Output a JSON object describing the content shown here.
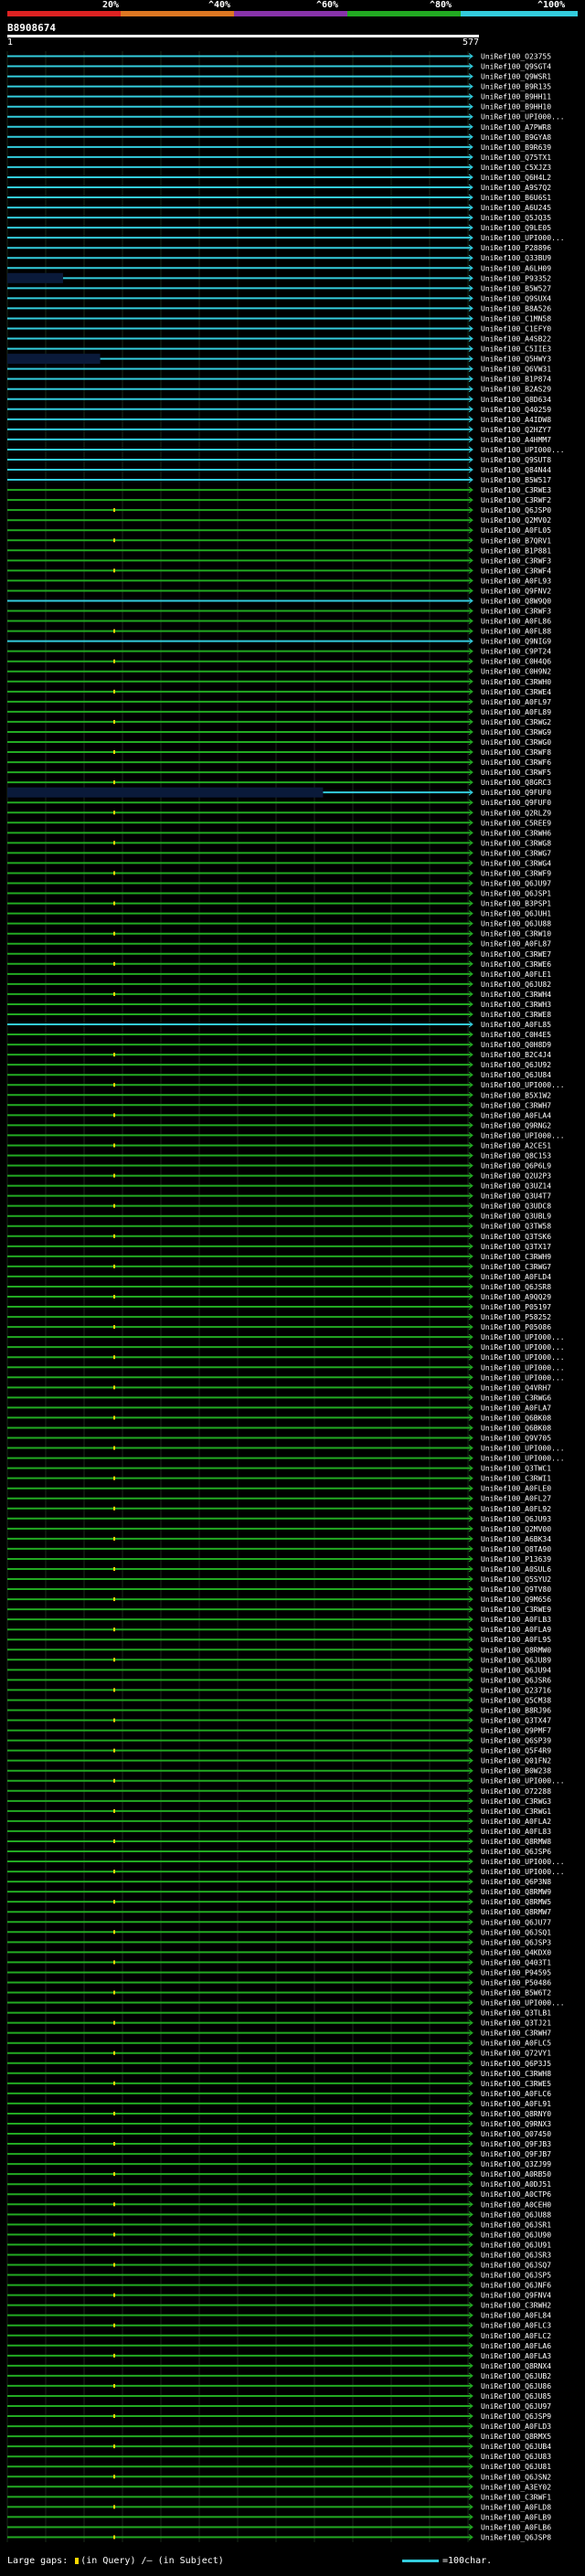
{
  "scale": {
    "labels": [
      "20%",
      "^40%",
      "^60%",
      "^80%",
      "^100%"
    ],
    "colors": [
      "#dd2222",
      "#dd7722",
      "#8833aa",
      "#22aa22",
      "#33ccdd"
    ]
  },
  "query": {
    "id": "B8908674",
    "start": "1",
    "end": "577"
  },
  "colors": {
    "cyan": "#33ccdd",
    "green": "#22aa22",
    "navy": "#0a1a3a",
    "dot": "#ffd700"
  },
  "hits": [
    {
      "id": "UniRef100_O23755",
      "c": "c"
    },
    {
      "id": "UniRef100_Q9SGT4",
      "c": "c"
    },
    {
      "id": "UniRef100_Q9WSR1",
      "c": "c"
    },
    {
      "id": "UniRef100_B9R135",
      "c": "c"
    },
    {
      "id": "UniRef100_B9HH11",
      "c": "c"
    },
    {
      "id": "UniRef100_B9HH10",
      "c": "c"
    },
    {
      "id": "UniRef100_UPI000...",
      "c": "c"
    },
    {
      "id": "UniRef100_A7PWR8",
      "c": "c"
    },
    {
      "id": "UniRef100_B9GYA8",
      "c": "c"
    },
    {
      "id": "UniRef100_B9R639",
      "c": "c"
    },
    {
      "id": "UniRef100_Q75TX1",
      "c": "c"
    },
    {
      "id": "UniRef100_C5XJZ3",
      "c": "c"
    },
    {
      "id": "UniRef100_Q6H4L2",
      "c": "c"
    },
    {
      "id": "UniRef100_A9S7Q2",
      "c": "c"
    },
    {
      "id": "UniRef100_B6U6S1",
      "c": "c"
    },
    {
      "id": "UniRef100_A6U245",
      "c": "c"
    },
    {
      "id": "UniRef100_Q5JQ35",
      "c": "c"
    },
    {
      "id": "UniRef100_Q9LE05",
      "c": "c"
    },
    {
      "id": "UniRef100_UPI000...",
      "c": "c"
    },
    {
      "id": "UniRef100_P28896",
      "c": "c"
    },
    {
      "id": "UniRef100_Q33BU9",
      "c": "c"
    },
    {
      "id": "UniRef100_A6LH09",
      "c": "c"
    },
    {
      "id": "UniRef100_P93352",
      "c": "c",
      "s": 0.12
    },
    {
      "id": "UniRef100_B5W527",
      "c": "c"
    },
    {
      "id": "UniRef100_Q9SUX4",
      "c": "c"
    },
    {
      "id": "UniRef100_B8A526",
      "c": "c"
    },
    {
      "id": "UniRef100_C1MN58",
      "c": "c"
    },
    {
      "id": "UniRef100_C1EFY0",
      "c": "c"
    },
    {
      "id": "UniRef100_A4SB22",
      "c": "c"
    },
    {
      "id": "UniRef100_C5IIE3",
      "c": "c"
    },
    {
      "id": "UniRef100_Q5HWY3",
      "c": "c",
      "s": 0.2
    },
    {
      "id": "UniRef100_Q6VW31",
      "c": "c"
    },
    {
      "id": "UniRef100_B1P874",
      "c": "c"
    },
    {
      "id": "UniRef100_B2AS29",
      "c": "c"
    },
    {
      "id": "UniRef100_Q8D634",
      "c": "c"
    },
    {
      "id": "UniRef100_Q40259",
      "c": "c"
    },
    {
      "id": "UniRef100_A4IDW8",
      "c": "c"
    },
    {
      "id": "UniRef100_Q2HZY7",
      "c": "c"
    },
    {
      "id": "UniRef100_A4HMM7",
      "c": "c"
    },
    {
      "id": "UniRef100_UPI000...",
      "c": "c"
    },
    {
      "id": "UniRef100_Q9SUT8",
      "c": "c"
    },
    {
      "id": "UniRef100_Q84N44",
      "c": "c"
    },
    {
      "id": "UniRef100_B5W517",
      "c": "c"
    },
    {
      "id": "UniRef100_C3RWE3",
      "c": "g"
    },
    {
      "id": "UniRef100_C3RWF2",
      "c": "g"
    },
    {
      "id": "UniRef100_Q6JSP0",
      "c": "g"
    },
    {
      "id": "UniRef100_Q2MV02",
      "c": "g"
    },
    {
      "id": "UniRef100_A0FL05",
      "c": "g"
    },
    {
      "id": "UniRef100_B7QRV1",
      "c": "g"
    },
    {
      "id": "UniRef100_B1P881",
      "c": "g"
    },
    {
      "id": "UniRef100_C3RWF3",
      "c": "g"
    },
    {
      "id": "UniRef100_C3RWF4",
      "c": "g"
    },
    {
      "id": "UniRef100_A0FL93",
      "c": "g"
    },
    {
      "id": "UniRef100_Q9FNV2",
      "c": "g"
    },
    {
      "id": "UniRef100_Q8W9Q0",
      "c": "c"
    },
    {
      "id": "UniRef100_C3RWF3",
      "c": "g"
    },
    {
      "id": "UniRef100_A0FL86",
      "c": "g"
    },
    {
      "id": "UniRef100_A0FL88",
      "c": "g"
    },
    {
      "id": "UniRef100_Q9NIG9",
      "c": "c"
    },
    {
      "id": "UniRef100_C9PT24",
      "c": "g"
    },
    {
      "id": "UniRef100_C0H4Q6",
      "c": "g"
    },
    {
      "id": "UniRef100_C0H9N2",
      "c": "g"
    },
    {
      "id": "UniRef100_C3RWH0",
      "c": "g"
    },
    {
      "id": "UniRef100_C3RWE4",
      "c": "g"
    },
    {
      "id": "UniRef100_A0FL97",
      "c": "g"
    },
    {
      "id": "UniRef100_A0FL89",
      "c": "g"
    },
    {
      "id": "UniRef100_C3RWG2",
      "c": "g"
    },
    {
      "id": "UniRef100_C3RWG9",
      "c": "g"
    },
    {
      "id": "UniRef100_C3RWG0",
      "c": "g"
    },
    {
      "id": "UniRef100_C3RWF8",
      "c": "g"
    },
    {
      "id": "UniRef100_C3RWF6",
      "c": "g"
    },
    {
      "id": "UniRef100_C3RWF5",
      "c": "g"
    },
    {
      "id": "UniRef100_Q8GRC3",
      "c": "g"
    },
    {
      "id": "UniRef100_Q9FUF0",
      "c": "c",
      "s": 0.68
    },
    {
      "id": "UniRef100_Q9FUF0",
      "c": "g"
    },
    {
      "id": "UniRef100_Q2RLZ9",
      "c": "g"
    },
    {
      "id": "UniRef100_C5REE9",
      "c": "g"
    },
    {
      "id": "UniRef100_C3RWH6",
      "c": "g"
    },
    {
      "id": "UniRef100_C3RWG8",
      "c": "g"
    },
    {
      "id": "UniRef100_C3RWG7",
      "c": "g"
    },
    {
      "id": "UniRef100_C3RWG4",
      "c": "g"
    },
    {
      "id": "UniRef100_C3RWF9",
      "c": "g"
    },
    {
      "id": "UniRef100_Q6JU97",
      "c": "g"
    },
    {
      "id": "UniRef100_Q6JSP1",
      "c": "g"
    },
    {
      "id": "UniRef100_B3PSP1",
      "c": "g"
    },
    {
      "id": "UniRef100_Q6JUH1",
      "c": "g"
    },
    {
      "id": "UniRef100_Q6JU88",
      "c": "g"
    },
    {
      "id": "UniRef100_C3RW10",
      "c": "g"
    },
    {
      "id": "UniRef100_A0FL87",
      "c": "g"
    },
    {
      "id": "UniRef100_C3RWE7",
      "c": "g"
    },
    {
      "id": "UniRef100_C3RWE6",
      "c": "g"
    },
    {
      "id": "UniRef100_A0FLE1",
      "c": "g"
    },
    {
      "id": "UniRef100_Q6JU82",
      "c": "g"
    },
    {
      "id": "UniRef100_C3RWH4",
      "c": "g"
    },
    {
      "id": "UniRef100_C3RWH3",
      "c": "g"
    },
    {
      "id": "UniRef100_C3RWE8",
      "c": "g"
    },
    {
      "id": "UniRef100_A0FL85",
      "c": "c"
    },
    {
      "id": "UniRef100_C0H4E5",
      "c": "g"
    },
    {
      "id": "UniRef100_Q0H8D9",
      "c": "g"
    },
    {
      "id": "UniRef100_B2C4J4",
      "c": "g"
    },
    {
      "id": "UniRef100_Q6JU92",
      "c": "g"
    },
    {
      "id": "UniRef100_Q6JU84",
      "c": "g"
    },
    {
      "id": "UniRef100_UPI000...",
      "c": "g"
    },
    {
      "id": "UniRef100_B5X1W2",
      "c": "g"
    },
    {
      "id": "UniRef100_C3RWH7",
      "c": "g"
    },
    {
      "id": "UniRef100_A0FLA4",
      "c": "g"
    },
    {
      "id": "UniRef100_Q9RNG2",
      "c": "g"
    },
    {
      "id": "UniRef100_UPI000...",
      "c": "g"
    },
    {
      "id": "UniRef100_A2CE51",
      "c": "g"
    },
    {
      "id": "UniRef100_Q8C153",
      "c": "g"
    },
    {
      "id": "UniRef100_Q6P6L9",
      "c": "g"
    },
    {
      "id": "UniRef100_Q2U2P3",
      "c": "g"
    },
    {
      "id": "UniRef100_Q3UZ14",
      "c": "g"
    },
    {
      "id": "UniRef100_Q3U4T7",
      "c": "g"
    },
    {
      "id": "UniRef100_Q3UDC8",
      "c": "g"
    },
    {
      "id": "UniRef100_Q3UBL9",
      "c": "g"
    },
    {
      "id": "UniRef100_Q3TW58",
      "c": "g"
    },
    {
      "id": "UniRef100_Q3TSK6",
      "c": "g"
    },
    {
      "id": "UniRef100_Q3TX17",
      "c": "g"
    },
    {
      "id": "UniRef100_C3RWH9",
      "c": "g"
    },
    {
      "id": "UniRef100_C3RWG7",
      "c": "g"
    },
    {
      "id": "UniRef100_A0FLD4",
      "c": "g"
    },
    {
      "id": "UniRef100_Q6JSR8",
      "c": "g"
    },
    {
      "id": "UniRef100_A9QQ29",
      "c": "g"
    },
    {
      "id": "UniRef100_P05197",
      "c": "g"
    },
    {
      "id": "UniRef100_P58252",
      "c": "g"
    },
    {
      "id": "UniRef100_P05086",
      "c": "g"
    },
    {
      "id": "UniRef100_UPI000...",
      "c": "g"
    },
    {
      "id": "UniRef100_UPI000...",
      "c": "g"
    },
    {
      "id": "UniRef100_UPI000...",
      "c": "g"
    },
    {
      "id": "UniRef100_UPI000...",
      "c": "g"
    },
    {
      "id": "UniRef100_UPI000...",
      "c": "g"
    },
    {
      "id": "UniRef100_Q4VRH7",
      "c": "g"
    },
    {
      "id": "UniRef100_C3RWG6",
      "c": "g"
    },
    {
      "id": "UniRef100_A0FLA7",
      "c": "g"
    },
    {
      "id": "UniRef100_Q6BK08",
      "c": "g"
    },
    {
      "id": "UniRef100_Q6BK08",
      "c": "g"
    },
    {
      "id": "UniRef100_Q9V705",
      "c": "g"
    },
    {
      "id": "UniRef100_UPI000...",
      "c": "g"
    },
    {
      "id": "UniRef100_UPI000...",
      "c": "g"
    },
    {
      "id": "UniRef100_Q3TWC1",
      "c": "g"
    },
    {
      "id": "UniRef100_C3RWI1",
      "c": "g"
    },
    {
      "id": "UniRef100_A0FLE0",
      "c": "g"
    },
    {
      "id": "UniRef100_A0FL27",
      "c": "g"
    },
    {
      "id": "UniRef100_A0FL92",
      "c": "g"
    },
    {
      "id": "UniRef100_Q6JU93",
      "c": "g"
    },
    {
      "id": "UniRef100_Q2MV00",
      "c": "g"
    },
    {
      "id": "UniRef100_A6BK34",
      "c": "g"
    },
    {
      "id": "UniRef100_Q8TA90",
      "c": "g"
    },
    {
      "id": "UniRef100_P13639",
      "c": "g"
    },
    {
      "id": "UniRef100_A0SUL6",
      "c": "g"
    },
    {
      "id": "UniRef100_Q5SYU2",
      "c": "g"
    },
    {
      "id": "UniRef100_Q9TV80",
      "c": "g"
    },
    {
      "id": "UniRef100_Q9M656",
      "c": "g"
    },
    {
      "id": "UniRef100_C3RWE9",
      "c": "g"
    },
    {
      "id": "UniRef100_A0FLB3",
      "c": "g"
    },
    {
      "id": "UniRef100_A0FLA9",
      "c": "g"
    },
    {
      "id": "UniRef100_A0FL95",
      "c": "g"
    },
    {
      "id": "UniRef100_Q8RMW0",
      "c": "g"
    },
    {
      "id": "UniRef100_Q6JU89",
      "c": "g"
    },
    {
      "id": "UniRef100_Q6JU94",
      "c": "g"
    },
    {
      "id": "UniRef100_Q6JSR6",
      "c": "g"
    },
    {
      "id": "UniRef100_Q23716",
      "c": "g"
    },
    {
      "id": "UniRef100_Q5CM38",
      "c": "g"
    },
    {
      "id": "UniRef100_B8RJ96",
      "c": "g"
    },
    {
      "id": "UniRef100_Q3TX47",
      "c": "g"
    },
    {
      "id": "UniRef100_Q9PMF7",
      "c": "g"
    },
    {
      "id": "UniRef100_Q6SP39",
      "c": "g"
    },
    {
      "id": "UniRef100_Q5F4R9",
      "c": "g"
    },
    {
      "id": "UniRef100_Q01FN2",
      "c": "g"
    },
    {
      "id": "UniRef100_B0W238",
      "c": "g"
    },
    {
      "id": "UniRef100_UPI000...",
      "c": "g"
    },
    {
      "id": "UniRef100_O72288",
      "c": "g"
    },
    {
      "id": "UniRef100_C3RWG3",
      "c": "g"
    },
    {
      "id": "UniRef100_C3RWG1",
      "c": "g"
    },
    {
      "id": "UniRef100_A0FLA2",
      "c": "g"
    },
    {
      "id": "UniRef100_A0FL83",
      "c": "g"
    },
    {
      "id": "UniRef100_Q8RMW8",
      "c": "g"
    },
    {
      "id": "UniRef100_Q6JSP6",
      "c": "g"
    },
    {
      "id": "UniRef100_UPI000...",
      "c": "g"
    },
    {
      "id": "UniRef100_UPI000...",
      "c": "g"
    },
    {
      "id": "UniRef100_Q6P3N8",
      "c": "g"
    },
    {
      "id": "UniRef100_Q8RMW9",
      "c": "g"
    },
    {
      "id": "UniRef100_Q8RMW5",
      "c": "g"
    },
    {
      "id": "UniRef100_Q8RMW7",
      "c": "g"
    },
    {
      "id": "UniRef100_Q6JU77",
      "c": "g"
    },
    {
      "id": "UniRef100_Q6JSQ1",
      "c": "g"
    },
    {
      "id": "UniRef100_Q6JSP3",
      "c": "g"
    },
    {
      "id": "UniRef100_Q4KDX0",
      "c": "g"
    },
    {
      "id": "UniRef100_Q403T1",
      "c": "g"
    },
    {
      "id": "UniRef100_P94595",
      "c": "g"
    },
    {
      "id": "UniRef100_P50486",
      "c": "g"
    },
    {
      "id": "UniRef100_B5W6T2",
      "c": "g"
    },
    {
      "id": "UniRef100_UPI000...",
      "c": "g"
    },
    {
      "id": "UniRef100_Q3TLB1",
      "c": "g"
    },
    {
      "id": "UniRef100_Q3TJ21",
      "c": "g"
    },
    {
      "id": "UniRef100_C3RWH7",
      "c": "g"
    },
    {
      "id": "UniRef100_A0FLC5",
      "c": "g"
    },
    {
      "id": "UniRef100_Q72VY1",
      "c": "g"
    },
    {
      "id": "UniRef100_Q6P3J5",
      "c": "g"
    },
    {
      "id": "UniRef100_C3RWH8",
      "c": "g"
    },
    {
      "id": "UniRef100_C3RWE5",
      "c": "g"
    },
    {
      "id": "UniRef100_A0FLC6",
      "c": "g"
    },
    {
      "id": "UniRef100_A0FL91",
      "c": "g"
    },
    {
      "id": "UniRef100_Q8RNY0",
      "c": "g"
    },
    {
      "id": "UniRef100_Q9RNX3",
      "c": "g"
    },
    {
      "id": "UniRef100_Q07450",
      "c": "g"
    },
    {
      "id": "UniRef100_Q9FJB3",
      "c": "g"
    },
    {
      "id": "UniRef100_Q9FJB7",
      "c": "g"
    },
    {
      "id": "UniRef100_Q3ZJ99",
      "c": "g"
    },
    {
      "id": "UniRef100_A0RB50",
      "c": "g"
    },
    {
      "id": "UniRef100_A0DJ51",
      "c": "g"
    },
    {
      "id": "UniRef100_A0CTP6",
      "c": "g"
    },
    {
      "id": "UniRef100_A0CEH0",
      "c": "g"
    },
    {
      "id": "UniRef100_Q6JU88",
      "c": "g"
    },
    {
      "id": "UniRef100_Q6JSR1",
      "c": "g"
    },
    {
      "id": "UniRef100_Q6JU90",
      "c": "g"
    },
    {
      "id": "UniRef100_Q6JU91",
      "c": "g"
    },
    {
      "id": "UniRef100_Q6JSR3",
      "c": "g"
    },
    {
      "id": "UniRef100_Q6JSQ7",
      "c": "g"
    },
    {
      "id": "UniRef100_Q6JSP5",
      "c": "g"
    },
    {
      "id": "UniRef100_Q6JNF6",
      "c": "g"
    },
    {
      "id": "UniRef100_Q9FNV4",
      "c": "g"
    },
    {
      "id": "UniRef100_C3RWH2",
      "c": "g"
    },
    {
      "id": "UniRef100_A0FL84",
      "c": "g"
    },
    {
      "id": "UniRef100_A0FLC3",
      "c": "g"
    },
    {
      "id": "UniRef100_A0FLC2",
      "c": "g"
    },
    {
      "id": "UniRef100_A0FLA6",
      "c": "g"
    },
    {
      "id": "UniRef100_A0FLA3",
      "c": "g"
    },
    {
      "id": "UniRef100_Q8RNX4",
      "c": "g"
    },
    {
      "id": "UniRef100_Q6JUB2",
      "c": "g"
    },
    {
      "id": "UniRef100_Q6JU86",
      "c": "g"
    },
    {
      "id": "UniRef100_Q6JU85",
      "c": "g"
    },
    {
      "id": "UniRef100_Q6JU97",
      "c": "g"
    },
    {
      "id": "UniRef100_Q6JSP9",
      "c": "g"
    },
    {
      "id": "UniRef100_A0FLD3",
      "c": "g"
    },
    {
      "id": "UniRef100_Q8RMX5",
      "c": "g"
    },
    {
      "id": "UniRef100_Q6JUB4",
      "c": "g"
    },
    {
      "id": "UniRef100_Q6JU83",
      "c": "g"
    },
    {
      "id": "UniRef100_Q6JU81",
      "c": "g"
    },
    {
      "id": "UniRef100_Q6JSN2",
      "c": "g"
    },
    {
      "id": "UniRef100_A3EY02",
      "c": "g"
    },
    {
      "id": "UniRef100_C3RWF1",
      "c": "g"
    },
    {
      "id": "UniRef100_A0FLD8",
      "c": "g"
    },
    {
      "id": "UniRef100_A0FLB9",
      "c": "g"
    },
    {
      "id": "UniRef100_A0FLB6",
      "c": "g"
    },
    {
      "id": "UniRef100_Q6JSP8",
      "c": "g"
    }
  ],
  "legend": {
    "large_gaps_label": "Large gaps:",
    "in_query_label": "(in Query)",
    "in_subject_label": "/— (in Subject)",
    "scale_label": "=100char."
  }
}
